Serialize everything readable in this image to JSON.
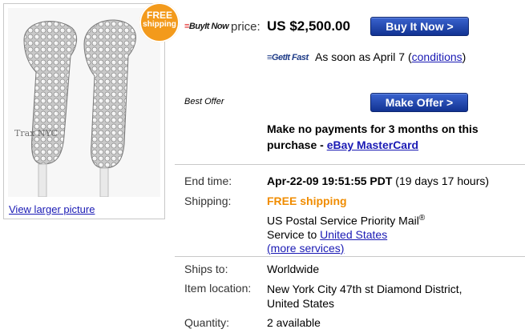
{
  "image_panel": {
    "badge_line1": "FREE",
    "badge_line2": "shipping",
    "watermark": "Trax NYC",
    "view_larger_link": "View larger picture"
  },
  "buy_now": {
    "logo_text": "BuyIt Now",
    "price_label": "price:",
    "price_value": "US $2,500.00",
    "button_label": "Buy It Now >"
  },
  "get_it_fast": {
    "logo_text": "GetIt Fast",
    "text": "As soon as April 7 (",
    "link": "conditions",
    "close": ")"
  },
  "best_offer": {
    "label": "Best Offer",
    "button_label": "Make Offer >"
  },
  "payments": {
    "text": "Make no payments for 3 months on this purchase - ",
    "link": "eBay MasterCard"
  },
  "details": {
    "end_time_label": "End time:",
    "end_time_value": "Apr-22-09 19:51:55 PDT",
    "end_time_remaining": "(19 days 17 hours)",
    "shipping_label": "Shipping:",
    "shipping_free": "FREE shipping",
    "shipping_service": "US Postal Service Priority Mail",
    "shipping_reg": "®",
    "shipping_to_text": "Service to ",
    "shipping_to_link": "United States",
    "more_services_link": "(more services)",
    "ships_to_label": "Ships to:",
    "ships_to_value": "Worldwide",
    "item_location_label": "Item location:",
    "item_location_line1": "New York City 47th st Diamond District,",
    "item_location_line2": "United States",
    "quantity_label": "Quantity:",
    "quantity_value": "2 available"
  },
  "colors": {
    "button_blue": "#1b3fa6",
    "free_orange": "#f08c00",
    "badge_orange": "#f39a1b",
    "link_blue": "#1a1ab4"
  }
}
